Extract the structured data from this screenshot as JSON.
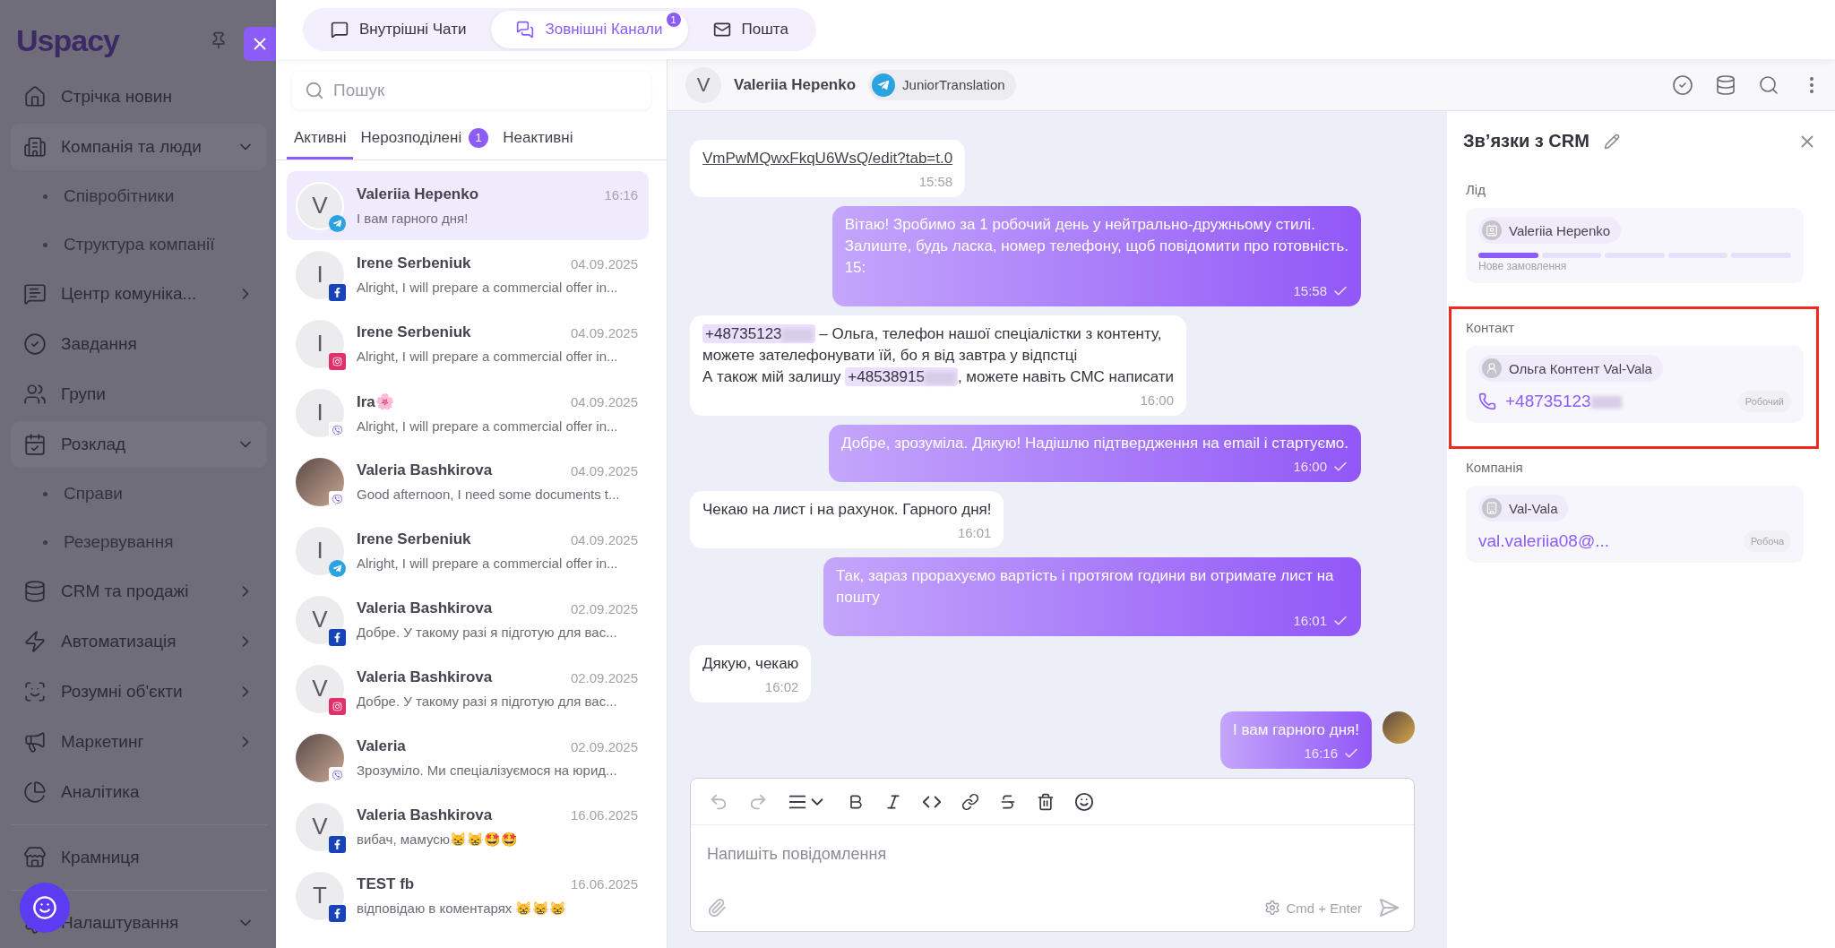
{
  "sidebar": {
    "logo": "Uspacy",
    "groups": [
      {
        "items": [
          {
            "label": "Стрічка новин"
          },
          {
            "label": "Компанія та люди",
            "expanded": true,
            "children": [
              {
                "label": "Співробітники"
              },
              {
                "label": "Структура компанії"
              }
            ]
          },
          {
            "label": "Центр комуніка...",
            "expanded": false
          },
          {
            "label": "Завдання"
          },
          {
            "label": "Групи"
          },
          {
            "label": "Розклад",
            "expanded": true,
            "children": [
              {
                "label": "Справи"
              },
              {
                "label": "Резервування"
              }
            ]
          },
          {
            "label": "CRM та продажі",
            "expanded": false
          },
          {
            "label": "Автоматизація",
            "expanded": false
          },
          {
            "label": "Розумні об'єкти",
            "expanded": false
          },
          {
            "label": "Маркетинг",
            "expanded": false
          },
          {
            "label": "Аналітика"
          }
        ]
      },
      {
        "items": [
          {
            "label": "Крамниця"
          }
        ]
      },
      {
        "items": [
          {
            "label": "Налаштування",
            "expanded": true
          }
        ]
      }
    ]
  },
  "top_tabs": [
    {
      "label": "Внутрішні Чати",
      "selected": false
    },
    {
      "label": "Зовнішні Канали",
      "selected": true,
      "badge": "1"
    },
    {
      "label": "Пошта",
      "selected": false
    }
  ],
  "chat_list": {
    "search": {
      "placeholder": "Пошук"
    },
    "tabs": [
      {
        "label": "Активні",
        "selected": true
      },
      {
        "label": "Нерозподілені",
        "selected": false,
        "badge": "1"
      },
      {
        "label": "Неактивні",
        "selected": false
      }
    ],
    "items": [
      {
        "name": "Valeriia Hepenko",
        "time": "16:16",
        "preview": "І вам гарного дня!",
        "avatar": "V",
        "photo": false,
        "kind": "telegram",
        "selected": true
      },
      {
        "name": "Irene Serbeniuk",
        "time": "04.09.2025",
        "preview": "Alright, I will prepare a commercial offer in...",
        "avatar": "I",
        "photo": false,
        "kind": "facebook",
        "selected": false
      },
      {
        "name": "Irene Serbeniuk",
        "time": "04.09.2025",
        "preview": "Alright, I will prepare a commercial offer in...",
        "avatar": "I",
        "photo": false,
        "kind": "instagram",
        "selected": false
      },
      {
        "name": "Ira🌸",
        "time": "04.09.2025",
        "preview": "Alright, I will prepare a commercial offer in...",
        "avatar": "I",
        "photo": false,
        "kind": "viber",
        "selected": false
      },
      {
        "name": "Valeria Bashkirova",
        "time": "04.09.2025",
        "preview": "Good afternoon, I need some documents t...",
        "photo": true,
        "kind": "viber",
        "selected": false
      },
      {
        "name": "Irene Serbeniuk",
        "time": "04.09.2025",
        "preview": "Alright, I will prepare a commercial offer in...",
        "avatar": "I",
        "photo": false,
        "kind": "telegram",
        "selected": false
      },
      {
        "name": "Valeria Bashkirova",
        "time": "02.09.2025",
        "preview": "Добре. У такому разі я підготую для вас...",
        "avatar": "V",
        "photo": false,
        "kind": "facebook",
        "selected": false
      },
      {
        "name": "Valeria Bashkirova",
        "time": "02.09.2025",
        "preview": "Добре. У такому разі я підготую для вас...",
        "avatar": "V",
        "photo": false,
        "kind": "instagram",
        "selected": false
      },
      {
        "name": "Valeria",
        "time": "02.09.2025",
        "preview": "Зрозуміло. Ми спеціалізуємося на юрид...",
        "photo": true,
        "kind": "viber",
        "selected": false
      },
      {
        "name": "Valeria Bashkirova",
        "time": "16.06.2025",
        "preview": "вибач, мамусю😸😸🤩🤩",
        "avatar": "V",
        "photo": false,
        "kind": "facebook",
        "selected": false
      },
      {
        "name": "TEST fb",
        "time": "16.06.2025",
        "preview": "відповідаю в коментарях 😸😸😸",
        "avatar": "T",
        "photo": false,
        "kind": "facebook",
        "selected": false
      }
    ]
  },
  "chat": {
    "header": {
      "avatar": "V",
      "name": "Valeriia Hepenko",
      "kind": "telegram",
      "account": "JuniorTranslation"
    },
    "messages": [
      {
        "kind": "in",
        "parts": [
          {
            "kind": "link",
            "text": "VmPwMQwxFkqU6WsQ/edit?tab=t.0"
          }
        ],
        "time": "15:58"
      },
      {
        "kind": "out",
        "parts": [
          {
            "kind": "text",
            "text": "Вітаю! Зробимо за 1 робочий день у нейтрально-дружньому стилі.\nЗалиште, будь ласка, номер телефону, щоб повідомити про готовність.\n15:"
          }
        ],
        "time": "15:58",
        "delivered": true
      },
      {
        "kind": "in",
        "parts": [
          {
            "kind": "phone",
            "text": "+48735123",
            "masked": true
          },
          {
            "kind": "text",
            "text": " – Ольга, телефон нашої спеціалістки з контенту,\nможете зателефонувати їй, бо я від завтра у відпстці\nА також мій залишу "
          },
          {
            "kind": "phone",
            "text": "+48538915",
            "masked": true
          },
          {
            "kind": "text",
            "text": ", можете навіть СМС написати"
          }
        ],
        "time": "16:00"
      },
      {
        "kind": "out",
        "parts": [
          {
            "kind": "text",
            "text": "Добре, зрозуміла. Дякую! Надішлю підтвердження на email і стартуємо."
          }
        ],
        "time": "16:00",
        "delivered": true
      },
      {
        "kind": "in",
        "parts": [
          {
            "kind": "text",
            "text": "Чекаю на лист і на рахунок. Гарного дня!"
          }
        ],
        "time": "16:01"
      },
      {
        "kind": "out",
        "parts": [
          {
            "kind": "text",
            "text": "Так, зараз прорахуємо вартість і протягом години ви отримате лист на пошту"
          }
        ],
        "time": "16:01",
        "delivered": true
      },
      {
        "kind": "in",
        "parts": [
          {
            "kind": "text",
            "text": "Дякую, чекаю"
          }
        ],
        "time": "16:02"
      },
      {
        "kind": "out",
        "parts": [
          {
            "kind": "text",
            "text": "І вам гарного дня!"
          }
        ],
        "time": "16:16",
        "delivered": true,
        "avatar": true
      }
    ],
    "composer": {
      "placeholder": "Напишіть повідомлення",
      "hint": "Cmd + Enter"
    }
  },
  "crm_panel": {
    "title": "Зв’язки з CRM",
    "sections": [
      {
        "kind": "lead",
        "label": "Лід",
        "name": "Valeriia Hepenko",
        "stages": [
          {
            "done": true
          },
          {
            "done": false
          },
          {
            "done": false
          },
          {
            "done": false
          },
          {
            "done": false
          }
        ],
        "stage": "Нове замовлення",
        "highlighted": false
      },
      {
        "kind": "contact",
        "label": "Контакт",
        "name": "Ольга Контент Val-Vala",
        "value": "+48735123",
        "masked": true,
        "tag": "Робочий",
        "highlighted": true
      },
      {
        "kind": "company",
        "label": "Компанія",
        "name": "Val-Vala",
        "value": "val.valeriia08@...",
        "masked": false,
        "tag": "Робоча",
        "highlighted": false
      }
    ]
  }
}
